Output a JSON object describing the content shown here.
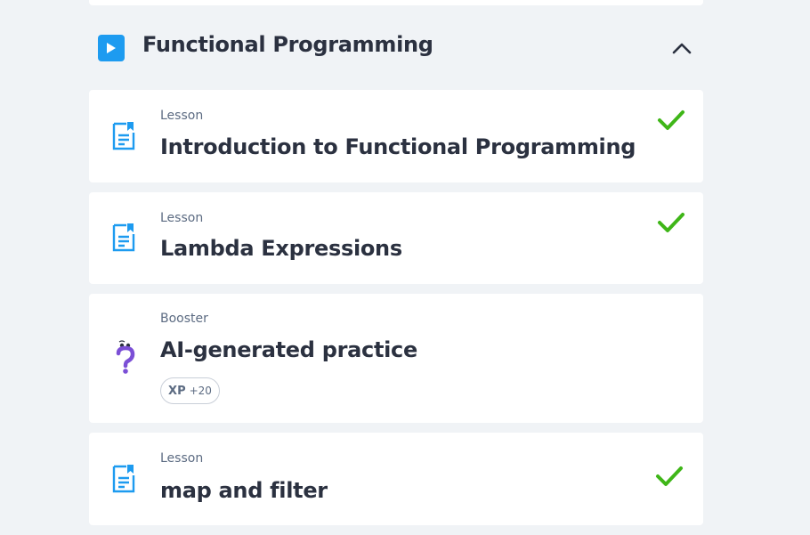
{
  "section": {
    "title": "Functional Programming",
    "play_icon": "play-icon",
    "collapse_icon": "chevron-up-icon"
  },
  "items": [
    {
      "type": "Lesson",
      "title": "Introduction to Functional Programming",
      "completed": true,
      "icon": "lesson-icon"
    },
    {
      "type": "Lesson",
      "title": "Lambda Expressions",
      "completed": true,
      "icon": "lesson-icon"
    },
    {
      "type": "Booster",
      "title": "AI-generated practice",
      "completed": false,
      "icon": "question-icon",
      "xp_label": "XP",
      "xp_value": "+20"
    },
    {
      "type": "Lesson",
      "title": "map and filter",
      "completed": true,
      "icon": "lesson-icon"
    }
  ],
  "colors": {
    "accent": "#1d9bf0",
    "check": "#3fb618",
    "booster": "#7b4fd6",
    "background": "#f0f3f6"
  }
}
